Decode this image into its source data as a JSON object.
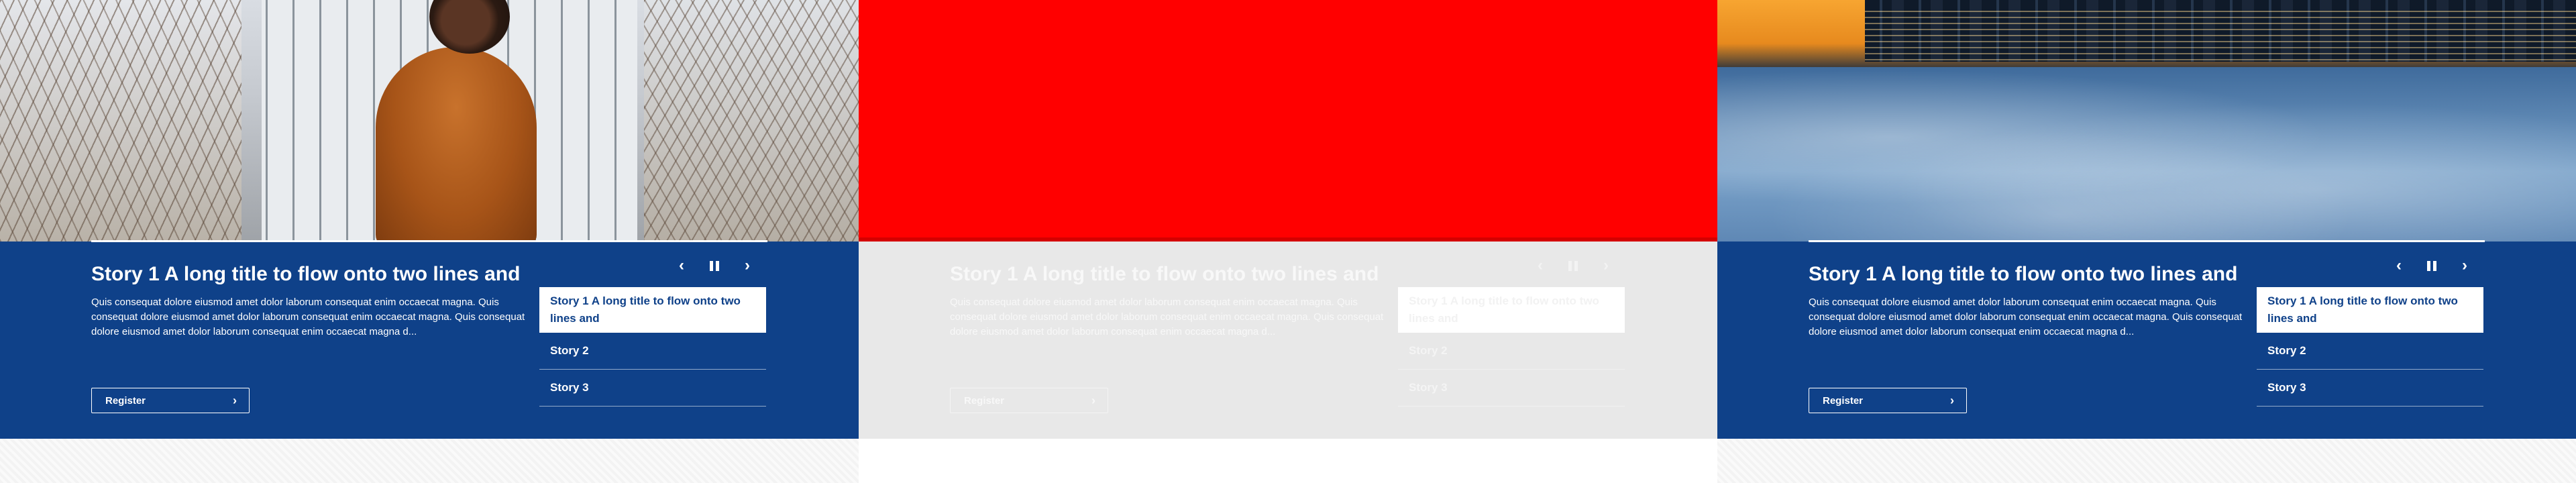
{
  "colors": {
    "brand_blue": "#0f4189",
    "hero_red": "#ff0000",
    "faded_grey": "#e8e8e8",
    "white": "#ffffff"
  },
  "icons": {
    "prev": "‹",
    "next": "›",
    "register_chevron": "›"
  },
  "slides": [
    {
      "title": "Story 1 A long title to flow onto two lines and",
      "description": "Quis consequat dolore eiusmod amet dolor laborum consequat enim occaecat magna. Quis consequat dolore eiusmod amet dolor laborum consequat enim occaecat magna. Quis consequat dolore eiusmod amet dolor laborum consequat enim occaecat magna d...",
      "register_label": "Register",
      "stories": [
        "Story 1 A long title to flow onto two lines and",
        "Story 2",
        "Story 3"
      ]
    },
    {
      "title": "Story 1 A long title to flow onto two lines and",
      "description": "Quis consequat dolore eiusmod amet dolor laborum consequat enim occaecat magna. Quis consequat dolore eiusmod amet dolor laborum consequat enim occaecat magna. Quis consequat dolore eiusmod amet dolor laborum consequat enim occaecat magna d...",
      "register_label": "Register",
      "stories": [
        "Story 1 A long title to flow onto two lines and",
        "Story 2",
        "Story 3"
      ]
    },
    {
      "title": "Story 1 A long title to flow onto two lines and",
      "description": "Quis consequat dolore eiusmod amet dolor laborum consequat enim occaecat magna. Quis consequat dolore eiusmod amet dolor laborum consequat enim occaecat magna. Quis consequat dolore eiusmod amet dolor laborum consequat enim occaecat magna d...",
      "register_label": "Register",
      "stories": [
        "Story 1 A long title to flow onto two lines and",
        "Story 2",
        "Story 3"
      ]
    }
  ]
}
